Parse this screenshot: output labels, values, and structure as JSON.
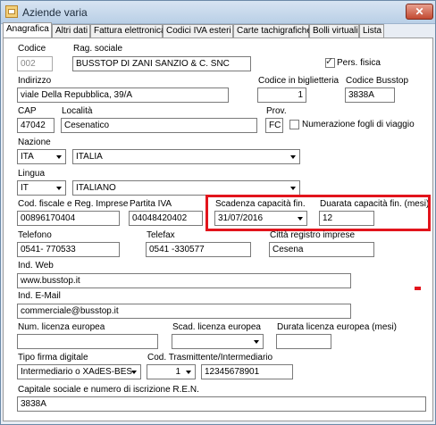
{
  "window": {
    "title": "Aziende varia",
    "close_glyph": "✕"
  },
  "tabs": [
    "Anagrafica",
    "Altri dati",
    "Fattura elettronica",
    "Codici IVA esteri",
    "Carte tachigrafiche",
    "Bolli virtuali",
    "Lista"
  ],
  "form": {
    "codice": {
      "label": "Codice",
      "value": "002"
    },
    "rag_sociale": {
      "label": "Rag. sociale",
      "value": "BUSSTOP DI ZANI SANZIO & C. SNC"
    },
    "pers_fisica": {
      "label": "Pers. fisica",
      "checked": true,
      "mark": "✓"
    },
    "indirizzo": {
      "label": "Indirizzo",
      "value": "viale Della Repubblica, 39/A"
    },
    "codice_biglietteria": {
      "label": "Codice in biglietteria",
      "value": "1"
    },
    "codice_busstop": {
      "label": "Codice Busstop",
      "value": "3838A"
    },
    "cap": {
      "label": "CAP",
      "value": "47042"
    },
    "localita": {
      "label": "Località",
      "value": "Cesenatico"
    },
    "prov": {
      "label": "Prov.",
      "value": "FC"
    },
    "numerazione": {
      "label": "Numerazione fogli di viaggio",
      "checked": false
    },
    "nazione": {
      "label": "Nazione",
      "code": "ITA",
      "name": "ITALIA"
    },
    "lingua": {
      "label": "Lingua",
      "code": "IT",
      "name": "ITALIANO"
    },
    "cod_fiscale": {
      "label": "Cod. fiscale e Reg. Imprese",
      "value": "00896170404"
    },
    "partita_iva": {
      "label": "Partita IVA",
      "value": "04048420402"
    },
    "scadenza": {
      "label": "Scadenza capacità fin.",
      "value": "31/07/2016"
    },
    "durata": {
      "label": "Duarata  capacità fin. (mesi)",
      "value": "12"
    },
    "telefono": {
      "label": "Telefono",
      "value": "0541- 770533"
    },
    "telefax": {
      "label": "Telefax",
      "value": "0541 -330577"
    },
    "citta_registro": {
      "label": "Città registro imprese",
      "value": "Cesena"
    },
    "web": {
      "label": "Ind. Web",
      "value": "www.busstop.it"
    },
    "email": {
      "label": "Ind. E-Mail",
      "value": "commerciale@busstop.it"
    },
    "num_licenza": {
      "label": "Num. licenza europea",
      "value": ""
    },
    "scad_licenza": {
      "label": "Scad. licenza europea",
      "value": ""
    },
    "durata_licenza": {
      "label": "Durata licenza europea (mesi)",
      "value": ""
    },
    "tipo_firma": {
      "label": "Tipo firma digitale",
      "value": "Intermediario o XAdES-BES"
    },
    "cod_trasmittente": {
      "label": "Cod. Trasmittente/Intermediario",
      "spin": "1",
      "value": "12345678901"
    },
    "capitale": {
      "label": "Capitale sociale e numero di iscrizione R.E.N.",
      "value": "3838A"
    }
  },
  "colors": {
    "highlight": "#e2141c",
    "titlebar": "#c8dbef",
    "close": "#c24a32"
  }
}
